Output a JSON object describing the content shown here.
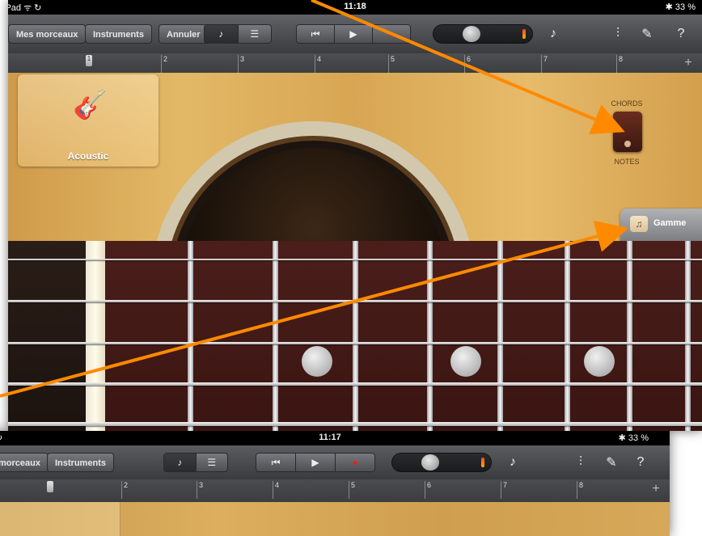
{
  "front": {
    "status": {
      "left": "iPad ᯤ ↻",
      "time": "11:18",
      "right": "✱ 33 %"
    },
    "toolbar": {
      "my_songs": "Mes morceaux",
      "instruments": "Instruments",
      "undo": "Annuler"
    },
    "ruler": [
      "1",
      "2",
      "3",
      "4",
      "5",
      "6",
      "7",
      "8"
    ],
    "instrument": {
      "name": "Acoustic"
    },
    "mode": {
      "top": "CHORDS",
      "bottom": "NOTES"
    },
    "scale_button": "Gamme"
  },
  "back": {
    "status": {
      "left": "↻",
      "time": "11:17",
      "right": "✱ 33 %"
    },
    "toolbar": {
      "my_songs": "morceaux",
      "instruments": "Instruments"
    },
    "ruler": [
      "1",
      "2",
      "3",
      "4",
      "5",
      "6",
      "7",
      "8"
    ]
  },
  "colors": {
    "arrow": "#ff8a00",
    "wood": "#d9a858",
    "fretboard": "#431a16"
  }
}
